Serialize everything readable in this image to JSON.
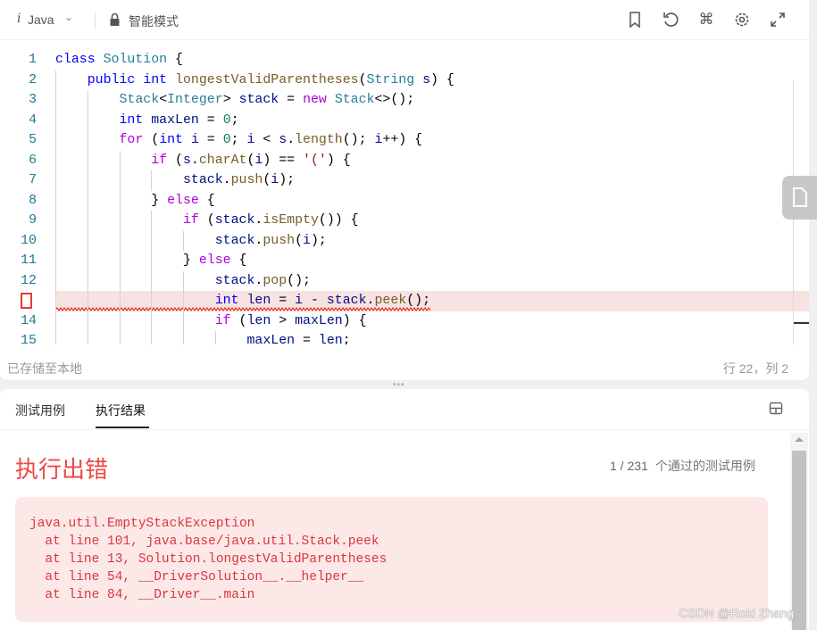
{
  "toolbar": {
    "lang_icon": "i",
    "language": "Java",
    "mode": "智能模式",
    "icons": [
      "bookmark-icon",
      "reset-icon",
      "command-icon",
      "settings-icon",
      "expand-icon"
    ]
  },
  "editor": {
    "error_line": 13,
    "lines": [
      {
        "n": "1",
        "indent": 0,
        "tokens": [
          [
            "class",
            "k"
          ],
          [
            " "
          ],
          [
            "Solution",
            "t"
          ],
          [
            " {"
          ]
        ]
      },
      {
        "n": "2",
        "indent": 1,
        "tokens": [
          [
            "public",
            "k"
          ],
          [
            " "
          ],
          [
            "int",
            "k"
          ],
          [
            " "
          ],
          [
            "longestValidParentheses",
            "m"
          ],
          [
            "("
          ],
          [
            "String",
            "t"
          ],
          [
            " "
          ],
          [
            "s",
            "v"
          ],
          [
            ") {"
          ]
        ]
      },
      {
        "n": "3",
        "indent": 2,
        "tokens": [
          [
            "Stack",
            "t"
          ],
          [
            "<"
          ],
          [
            "Integer",
            "t"
          ],
          [
            "> "
          ],
          [
            "stack",
            "v"
          ],
          [
            " = "
          ],
          [
            "new",
            "c"
          ],
          [
            " "
          ],
          [
            "Stack",
            "t"
          ],
          [
            "<>();"
          ]
        ]
      },
      {
        "n": "4",
        "indent": 2,
        "tokens": [
          [
            "int",
            "k"
          ],
          [
            " "
          ],
          [
            "maxLen",
            "v"
          ],
          [
            " = "
          ],
          [
            "0",
            "n"
          ],
          [
            ";"
          ]
        ]
      },
      {
        "n": "5",
        "indent": 2,
        "tokens": [
          [
            "for",
            "c"
          ],
          [
            " ("
          ],
          [
            "int",
            "k"
          ],
          [
            " "
          ],
          [
            "i",
            "v"
          ],
          [
            " = "
          ],
          [
            "0",
            "n"
          ],
          [
            "; "
          ],
          [
            "i",
            "v"
          ],
          [
            " < "
          ],
          [
            "s",
            "v"
          ],
          [
            "."
          ],
          [
            "length",
            "m"
          ],
          [
            "(); "
          ],
          [
            "i",
            "v"
          ],
          [
            "++) {"
          ]
        ]
      },
      {
        "n": "6",
        "indent": 3,
        "tokens": [
          [
            "if",
            "c"
          ],
          [
            " ("
          ],
          [
            "s",
            "v"
          ],
          [
            "."
          ],
          [
            "charAt",
            "m"
          ],
          [
            "("
          ],
          [
            "i",
            "v"
          ],
          [
            ") == "
          ],
          [
            "'('",
            "s"
          ],
          [
            ") {"
          ]
        ]
      },
      {
        "n": "7",
        "indent": 4,
        "tokens": [
          [
            "stack",
            "v"
          ],
          [
            "."
          ],
          [
            "push",
            "m"
          ],
          [
            "("
          ],
          [
            "i",
            "v"
          ],
          [
            ");"
          ]
        ]
      },
      {
        "n": "8",
        "indent": 3,
        "tokens": [
          [
            "} "
          ],
          [
            "else",
            "c"
          ],
          [
            " {"
          ]
        ]
      },
      {
        "n": "9",
        "indent": 4,
        "tokens": [
          [
            "if",
            "c"
          ],
          [
            " ("
          ],
          [
            "stack",
            "v"
          ],
          [
            "."
          ],
          [
            "isEmpty",
            "m"
          ],
          [
            "()) {"
          ]
        ]
      },
      {
        "n": "10",
        "indent": 5,
        "tokens": [
          [
            "stack",
            "v"
          ],
          [
            "."
          ],
          [
            "push",
            "m"
          ],
          [
            "("
          ],
          [
            "i",
            "v"
          ],
          [
            ");"
          ]
        ]
      },
      {
        "n": "11",
        "indent": 4,
        "tokens": [
          [
            "} "
          ],
          [
            "else",
            "c"
          ],
          [
            " {"
          ]
        ]
      },
      {
        "n": "12",
        "indent": 5,
        "tokens": [
          [
            "stack",
            "v"
          ],
          [
            "."
          ],
          [
            "pop",
            "m"
          ],
          [
            "();"
          ]
        ]
      },
      {
        "n": "13",
        "indent": 5,
        "tokens": [
          [
            "int",
            "k"
          ],
          [
            " "
          ],
          [
            "len",
            "v"
          ],
          [
            " = "
          ],
          [
            "i",
            "v"
          ],
          [
            " - "
          ],
          [
            "stack",
            "v"
          ],
          [
            "."
          ],
          [
            "peek",
            "m"
          ],
          [
            "();"
          ]
        ]
      },
      {
        "n": "14",
        "indent": 5,
        "tokens": [
          [
            "if",
            "c"
          ],
          [
            " ("
          ],
          [
            "len",
            "v"
          ],
          [
            " > "
          ],
          [
            "maxLen",
            "v"
          ],
          [
            ") {"
          ]
        ]
      },
      {
        "n": "15",
        "indent": 6,
        "tokens": [
          [
            "maxLen",
            "v"
          ],
          [
            " = "
          ],
          [
            "len",
            "v"
          ],
          [
            ";"
          ]
        ]
      }
    ]
  },
  "status": {
    "saved": "已存储至本地",
    "cursor": "行 22，列 2"
  },
  "bottom": {
    "tabs": [
      {
        "label": "测试用例"
      },
      {
        "label": "执行结果",
        "active": true
      }
    ],
    "result_title": "执行出错",
    "passed": "1 / 231",
    "passed_label": "个通过的测试用例",
    "error_text": "java.util.EmptyStackException\n  at line 101, java.base/java.util.Stack.peek\n  at line 13, Solution.longestValidParentheses\n  at line 54, __DriverSolution__.__helper__\n  at line 84, __Driver__.main"
  },
  "watermark": "CSDN @Roki Zhang",
  "colors": {
    "error": "#ef4743",
    "error_bg": "#fde8e8",
    "line_number": "#237893"
  }
}
